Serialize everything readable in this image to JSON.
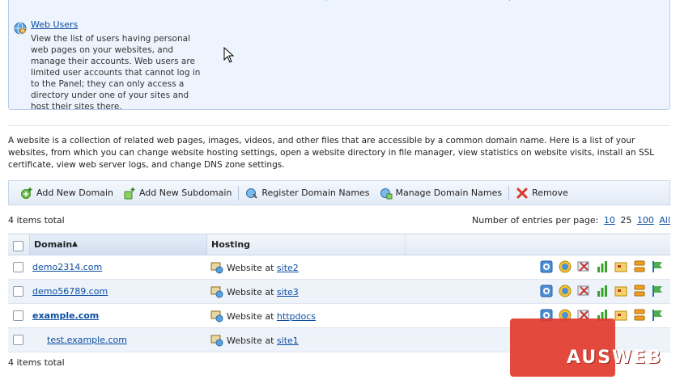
{
  "webusers": {
    "title": "Web Users",
    "description": "View the list of users having personal web pages on your websites, and manage their accounts. Web users are limited user accounts that cannot log in to the Panel; they can only access a directory under one of your sites and host their sites there."
  },
  "intro": "A website is a collection of related web pages, images, videos, and other files that are accessible by a common domain name. Here is a list of your websites, from which you can change website hosting settings, open a website directory in file manager, view statistics on website visits, install an SSL certificate, view web server logs, and change DNS zone settings.",
  "toolbar": {
    "add_domain": "Add New Domain",
    "add_subdomain": "Add New Subdomain",
    "register": "Register Domain Names",
    "manage": "Manage Domain Names",
    "remove": "Remove"
  },
  "total_top": "4 items total",
  "total_bottom": "4 items total",
  "pagination": {
    "label": "Number of entries per page:",
    "options": [
      "10",
      "25",
      "100",
      "All"
    ],
    "selected": "25"
  },
  "table": {
    "col_domain": "Domain",
    "sort_indicator": "▲",
    "col_hosting": "Hosting",
    "rows": [
      {
        "domain": "demo2314.com",
        "hosting_prefix": "Website at",
        "hosting_target": "site2"
      },
      {
        "domain": "demo56789.com",
        "hosting_prefix": "Website at",
        "hosting_target": "site3"
      },
      {
        "domain": "example.com",
        "hosting_prefix": "Website at",
        "hosting_target": "httpdocs"
      },
      {
        "domain": "test.example.com",
        "hosting_prefix": "Website at",
        "hosting_target": "site1"
      }
    ]
  },
  "watermark": "AUSWEB",
  "colors": {
    "link": "#0b4da2",
    "watermark": "#e23a2c",
    "panel_bg": "#eef4fd"
  }
}
